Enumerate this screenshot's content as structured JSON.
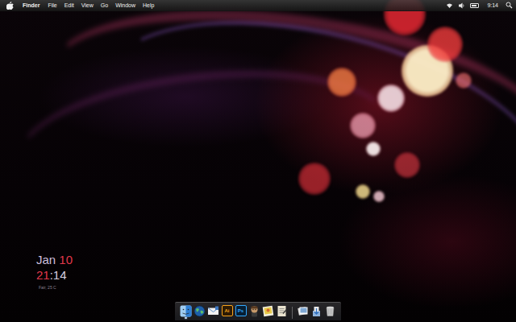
{
  "menubar": {
    "app": "Finder",
    "menus": [
      "File",
      "Edit",
      "View",
      "Go",
      "Window",
      "Help"
    ],
    "battery": {
      "level": 0.8
    },
    "clock": "9:14"
  },
  "clock_widget": {
    "month": "Jan",
    "day": "10",
    "hour": "21",
    "minutes": ":14",
    "weather": "Fair, 25 C"
  },
  "dock": {
    "items": [
      {
        "kind": "finder",
        "running": true
      },
      {
        "kind": "globe",
        "running": false
      },
      {
        "kind": "mail",
        "running": false
      },
      {
        "kind": "ai",
        "text": "Ai",
        "running": false
      },
      {
        "kind": "ps",
        "text": "Ps",
        "running": false
      },
      {
        "kind": "character",
        "running": false
      },
      {
        "kind": "photo",
        "running": false
      },
      {
        "kind": "script",
        "running": false
      },
      {
        "kind": "separator",
        "running": false
      },
      {
        "kind": "preview",
        "running": false
      },
      {
        "kind": "stack",
        "running": false
      },
      {
        "kind": "trash",
        "running": false
      }
    ]
  }
}
